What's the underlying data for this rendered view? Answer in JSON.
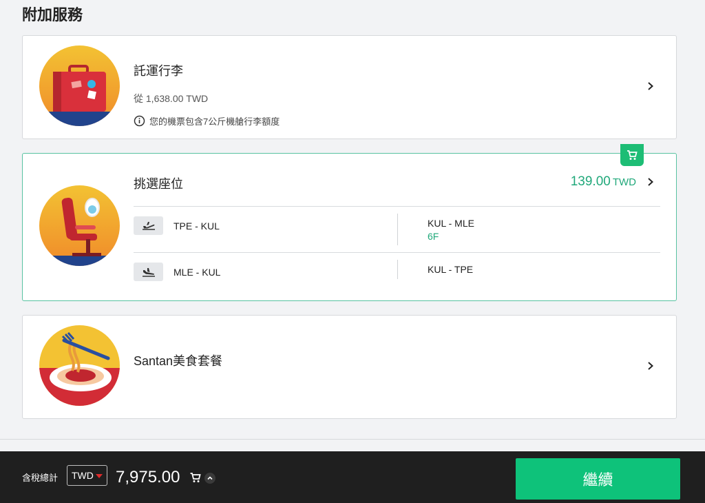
{
  "page": {
    "title": "附加服務"
  },
  "baggage": {
    "title": "託運行李",
    "price_from": "從 1,638.00 TWD",
    "note": "您的機票包含7公斤機艙行李額度",
    "illustration": "suitcase-illustration"
  },
  "seats": {
    "title": "挑選座位",
    "price": "139.00",
    "currency": "TWD",
    "badge_icon": "cart-icon",
    "segments": [
      {
        "left_route": "TPE - KUL",
        "right_route": "KUL - MLE",
        "right_seat": "6F",
        "icon": "takeoff-icon"
      },
      {
        "left_route": "MLE - KUL",
        "right_route": "KUL - TPE",
        "right_seat": "",
        "icon": "landing-icon"
      }
    ]
  },
  "meals": {
    "title": "Santan美食套餐",
    "illustration": "pasta-illustration"
  },
  "footer": {
    "tax_label": "含稅總計",
    "currency": "TWD",
    "total": "7,975.00",
    "continue_label": "繼續"
  },
  "colors": {
    "accent_green": "#1dbd75",
    "price_green": "#20a87a",
    "footer_bg": "#1f1f1f",
    "continue_bg": "#0ec27a"
  }
}
